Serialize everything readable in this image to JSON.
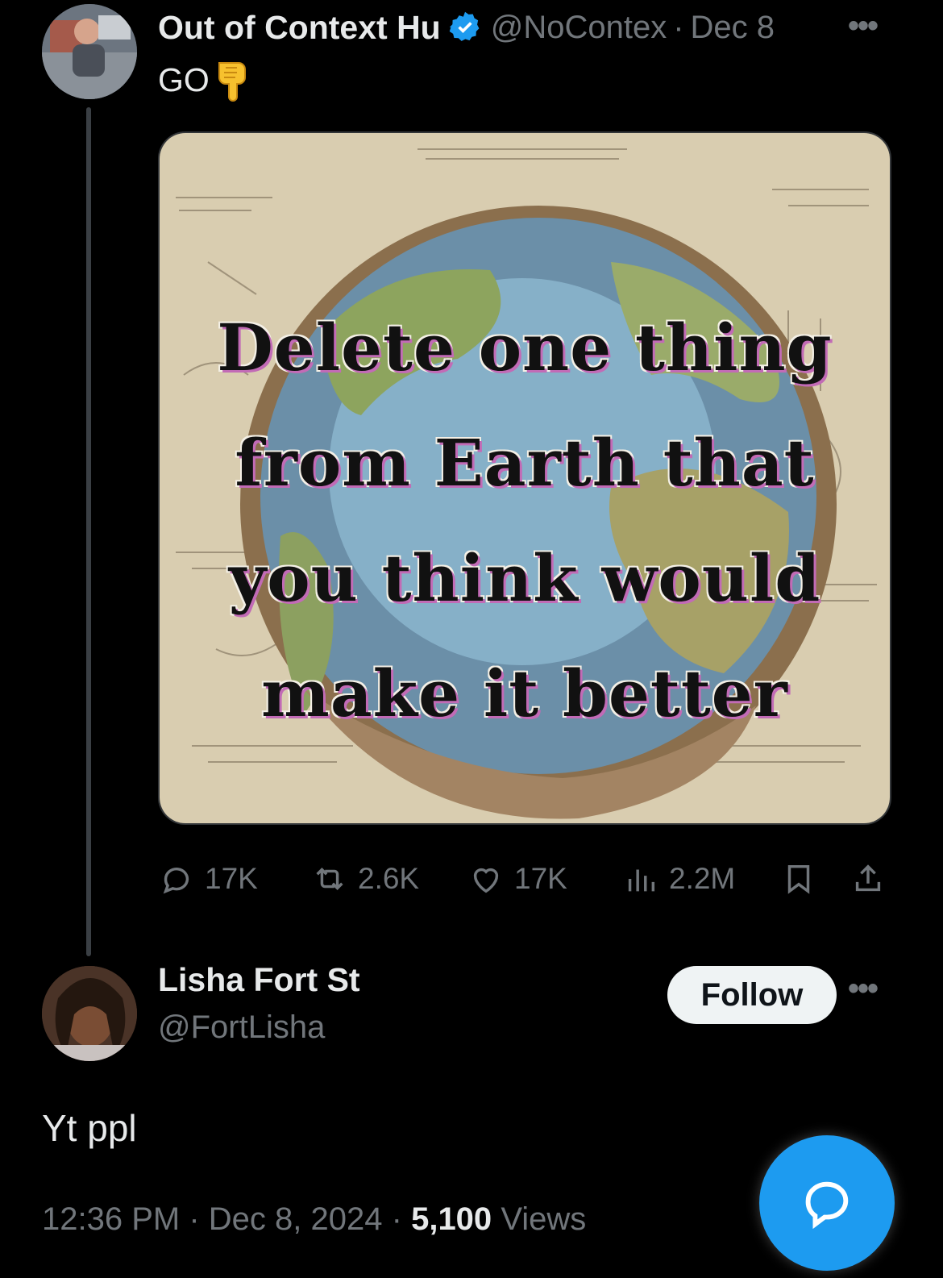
{
  "parent_tweet": {
    "author_name": "Out of Context Hu",
    "handle": "@NoContex",
    "separator": "·",
    "date": "Dec 8",
    "text": "GO",
    "image_caption": "Delete one thing from Earth that you think would make it better",
    "stats": {
      "replies": "17K",
      "retweets": "2.6K",
      "likes": "17K",
      "views": "2.2M"
    }
  },
  "reply": {
    "author_name": "Lisha Fort St",
    "handle": "@FortLisha",
    "follow_label": "Follow",
    "text": "Yt ppl",
    "time": "12:36 PM",
    "separator": "·",
    "date": "Dec 8, 2024",
    "views_count": "5,100",
    "views_label": "Views"
  },
  "colors": {
    "background": "#000000",
    "text_primary": "#e7e9ea",
    "text_secondary": "#71767b",
    "accent": "#1d9bf0",
    "follow_button_bg": "#eff3f4"
  }
}
